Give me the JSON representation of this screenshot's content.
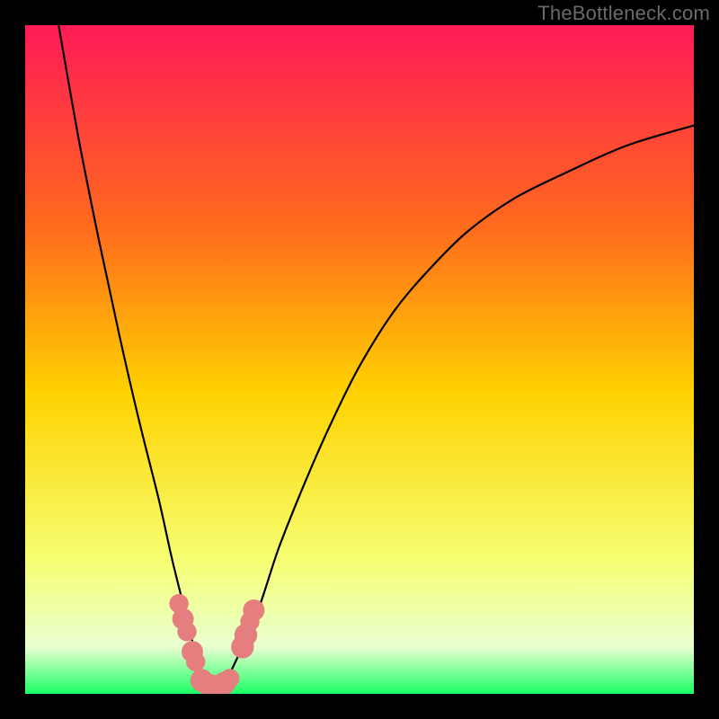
{
  "watermark": "TheBottleneck.com",
  "colors": {
    "frame": "#000000",
    "watermark": "#6a6a6a",
    "curve": "#000000",
    "marker_fill": "#e57f7f",
    "marker_stroke": "#e57f7f",
    "gradient_top": "#ff1a57",
    "gradient_q1": "#ff6a1d",
    "gradient_mid": "#ffd200",
    "gradient_q3": "#f6ff73",
    "gradient_low": "#e9ffd0",
    "gradient_bottom": "#1aff66"
  },
  "chart_data": {
    "type": "line",
    "title": "",
    "xlabel": "",
    "ylabel": "",
    "xlim": [
      0,
      100
    ],
    "ylim": [
      0,
      100
    ],
    "grid": false,
    "legend": false,
    "series": [
      {
        "name": "bottleneck-curve",
        "x": [
          5,
          8,
          11,
          14,
          17,
          20,
          22,
          24,
          25.5,
          27,
          28.5,
          30,
          32,
          35,
          38,
          42,
          46,
          50,
          55,
          60,
          66,
          73,
          81,
          90,
          100
        ],
        "y": [
          100,
          83,
          68,
          54,
          41,
          29,
          20,
          12,
          6,
          2,
          1,
          2,
          6,
          13,
          22,
          32,
          41,
          49,
          57,
          63,
          69,
          74,
          78,
          82,
          85
        ]
      }
    ],
    "markers": [
      {
        "x": 23.0,
        "y": 13.5,
        "r": 1.0
      },
      {
        "x": 23.6,
        "y": 11.2,
        "r": 1.2
      },
      {
        "x": 24.2,
        "y": 9.3,
        "r": 1.0
      },
      {
        "x": 25.0,
        "y": 6.3,
        "r": 1.2
      },
      {
        "x": 25.5,
        "y": 4.8,
        "r": 1.0
      },
      {
        "x": 26.4,
        "y": 2.0,
        "r": 1.3
      },
      {
        "x": 27.5,
        "y": 1.3,
        "r": 1.3
      },
      {
        "x": 28.3,
        "y": 1.0,
        "r": 1.0
      },
      {
        "x": 29.0,
        "y": 1.2,
        "r": 1.3
      },
      {
        "x": 29.8,
        "y": 1.6,
        "r": 1.3
      },
      {
        "x": 30.6,
        "y": 2.3,
        "r": 1.0
      },
      {
        "x": 32.5,
        "y": 7.0,
        "r": 1.3
      },
      {
        "x": 33.0,
        "y": 8.8,
        "r": 1.3
      },
      {
        "x": 33.6,
        "y": 10.8,
        "r": 1.0
      },
      {
        "x": 34.2,
        "y": 12.5,
        "r": 1.2
      }
    ]
  }
}
